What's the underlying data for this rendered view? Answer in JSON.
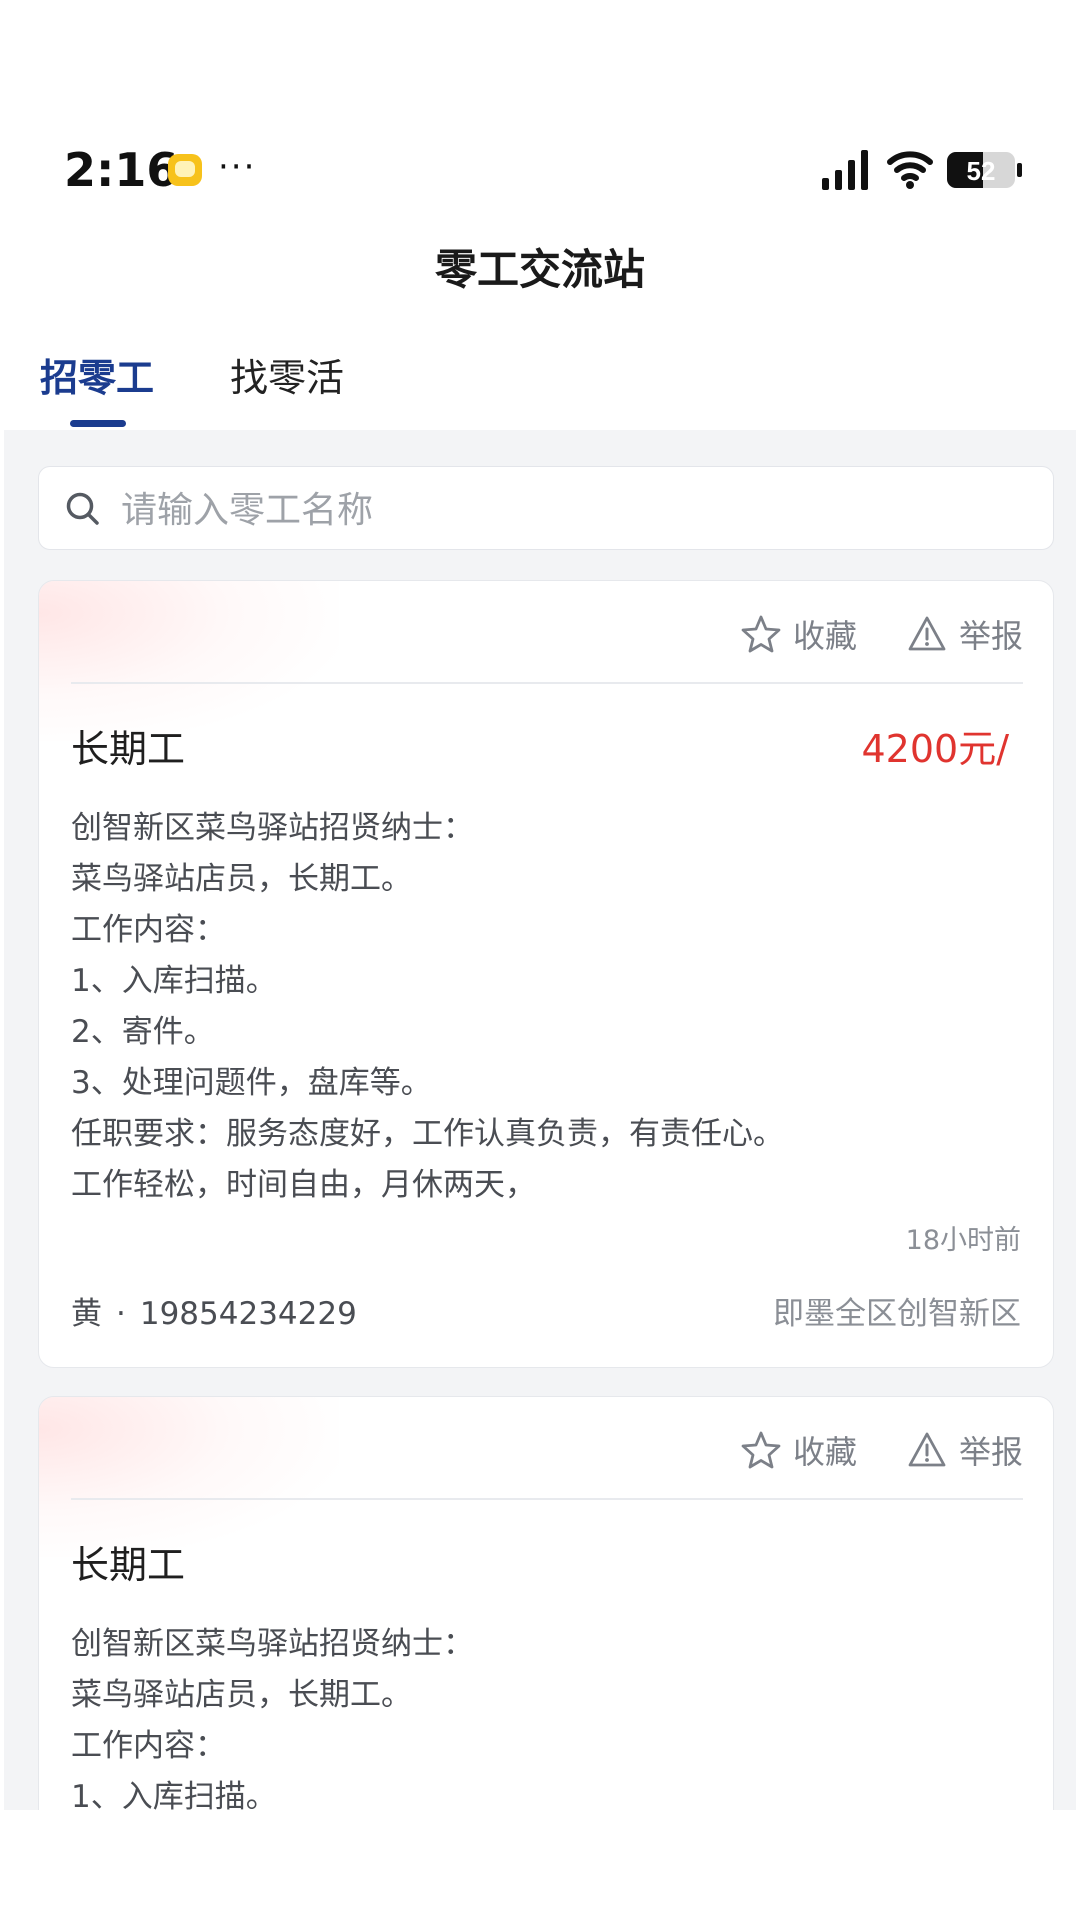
{
  "status_bar": {
    "time": "2:16",
    "more": "···",
    "battery": "52"
  },
  "header": {
    "title": "零工交流站"
  },
  "tabs": [
    {
      "label": "招零工"
    },
    {
      "label": "找零活"
    }
  ],
  "search": {
    "placeholder": "请输入零工名称"
  },
  "cards": [
    {
      "favorite_label": "收藏",
      "report_label": "举报",
      "title": "长期工",
      "salary": "4200元/",
      "description": [
        "创智新区菜鸟驿站招贤纳士：",
        "菜鸟驿站店员，长期工。",
        "工作内容：",
        "1、入库扫描。",
        "2、寄件。",
        "3、处理问题件，盘库等。",
        "任职要求：服务态度好，工作认真负责，有责任心。",
        "工作轻松，时间自由，月休两天，"
      ],
      "posted": "18小时前",
      "contact_name": "黄",
      "contact_separator": "·",
      "contact_phone": "19854234229",
      "location": "即墨全区创智新区"
    },
    {
      "favorite_label": "收藏",
      "report_label": "举报",
      "title": "长期工",
      "description": [
        "创智新区菜鸟驿站招贤纳士：",
        "菜鸟驿站店员，长期工。",
        "工作内容：",
        "1、入库扫描。"
      ]
    }
  ],
  "colors": {
    "accent": "#1b3c8f",
    "salary": "#e0342f",
    "background": "#f3f4f6"
  },
  "icons": {
    "search": "search-icon",
    "favorite": "star-outline-icon",
    "report": "warning-triangle-icon"
  }
}
